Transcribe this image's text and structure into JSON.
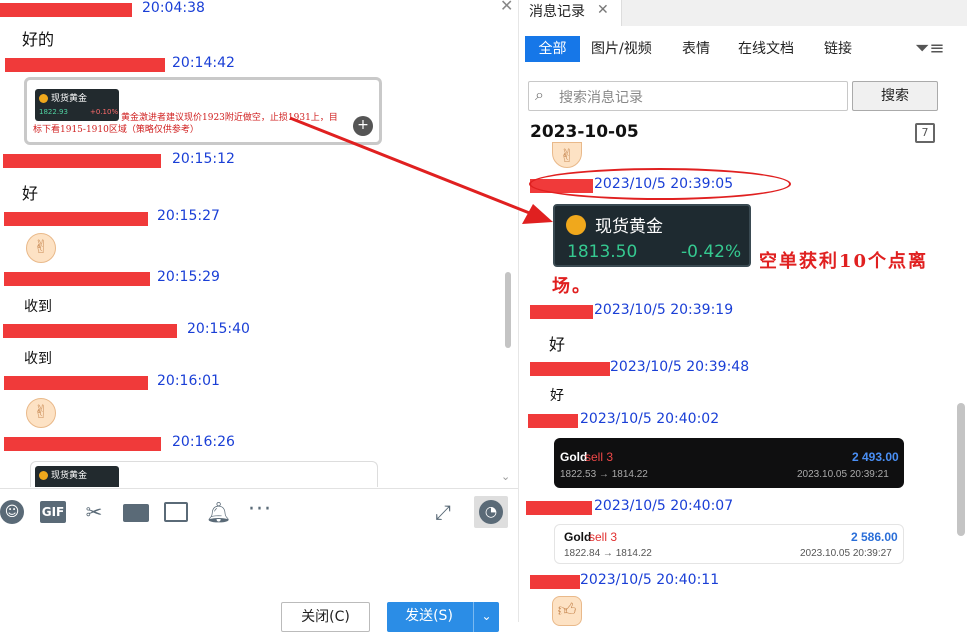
{
  "left_chat": {
    "messages": [
      {
        "time": "20:04:38",
        "text": "好的"
      },
      {
        "time": "20:14:42",
        "card": {
          "title": "现货黄金",
          "price": "1822.93",
          "change": "+0.10%"
        },
        "caption_line1": "黄金激进者建议现价1923附近做空，止损1931上，目",
        "caption_line2": "标下看1915-1910区域（策略仅供参考）"
      },
      {
        "time": "20:15:12",
        "text": "好"
      },
      {
        "time": "20:15:27"
      },
      {
        "time": "20:15:29",
        "text": "收到"
      },
      {
        "time": "20:15:40",
        "text": "收到"
      },
      {
        "time": "20:16:01"
      },
      {
        "time": "20:16:26",
        "card": {
          "title": "现货黄金"
        }
      }
    ],
    "toolbar_icons": [
      "emoji-icon",
      "gif-icon",
      "scissors-icon",
      "folder-icon",
      "image-icon",
      "bell-icon",
      "more-icon",
      "expand-icon",
      "history-icon"
    ],
    "gif_label": "GIF",
    "close_button": "关闭(C)",
    "send_button": "发送(S)"
  },
  "history": {
    "tab_title": "消息记录",
    "filters": [
      "全部",
      "图片/视频",
      "表情",
      "在线文档",
      "链接"
    ],
    "search_placeholder": "搜索消息记录",
    "search_button": "搜索",
    "date": "2023-10-05",
    "messages": [
      {
        "time": "2023/10/5 20:39:05",
        "card": {
          "title": "现货黄金",
          "price": "1813.50",
          "change": "-0.42%"
        }
      },
      {
        "time": "2023/10/5 20:39:19",
        "text": "好"
      },
      {
        "time": "2023/10/5 20:39:48",
        "text": "好"
      },
      {
        "time": "2023/10/5 20:40:02",
        "trade": {
          "symbol": "Gold",
          "side": "sell 3",
          "amount": "2 493.00",
          "prices": "1822.53 → 1814.22",
          "date": "2023.10.05 20:39:21"
        }
      },
      {
        "time": "2023/10/5 20:40:07",
        "trade": {
          "symbol": "Gold",
          "side": "sell 3",
          "amount": "2 586.00",
          "prices": "1822.84 → 1814.22",
          "date": "2023.10.05 20:39:27"
        }
      },
      {
        "time": "2023/10/5 20:40:11"
      }
    ]
  },
  "annotation": {
    "line1": "空单获利10个点离",
    "line2": "场。"
  },
  "colors": {
    "accent": "#1677e8",
    "link": "#1a3fd6",
    "redact": "#f03a3a",
    "annot": "#e02020"
  }
}
